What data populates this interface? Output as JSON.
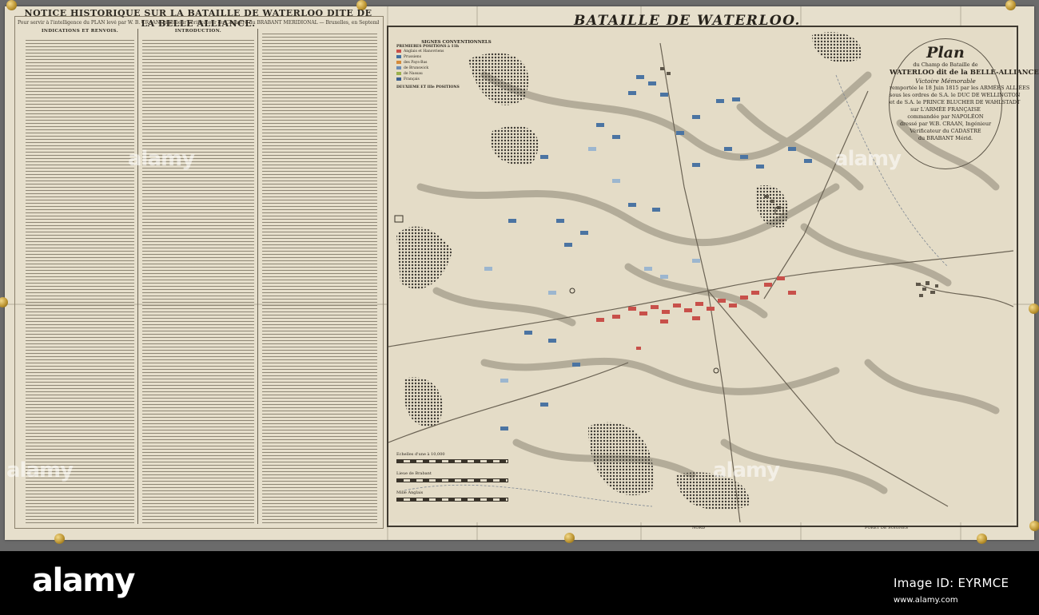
{
  "notice": {
    "title": "NOTICE HISTORIQUE SUR LA BATAILLE DE WATERLOO DITE DE LA BELLE ALLIANCE.",
    "subtitle": "Pour servir à l'intelligence du PLAN levé par W. B. CRAAN, Ingénieur Vérificateur du Cadastre du BRABANT MERIDIONAL — Bruxelles, en Septembre 1816.",
    "col1_head": "INDICATIONS ET RENVOIS.",
    "col2_head": "INTRODUCTION."
  },
  "map": {
    "title": "BATAILLE DE WATERLOO.",
    "cartouche": {
      "plan": "Plan",
      "l1": "du Champ de Bataille de",
      "l2": "WATERLOO dit de la BELLE-ALLIANCE,",
      "l3": "Victoire Mémorable",
      "l4": "remportée le 18 Juin 1815 par les ARMÉES ALLIÉES",
      "l5": "sous les ordres de S.A. le DUC DE WELLINGTON",
      "l6": "et de S.A. le PRINCE BLUCHER DE WAHLSTADT",
      "l7": "sur L'ARMÉE FRANÇAISE",
      "l8": "commandée par NAPOLÉON",
      "l9": "dressé par W.B. CRAAN, Ingénieur",
      "l10": "Vérificateur du CADASTRE",
      "l11": "du BRABANT Mérid."
    },
    "legend": {
      "head": "SIGNES CONVENTIONNELS",
      "sub1": "PREMIERES POSITIONS à 11h",
      "rows": [
        {
          "label": "Anglais et Hanovriens",
          "color": "#c8504a"
        },
        {
          "label": "Prussiens",
          "color": "#3f6fa0"
        },
        {
          "label": "des Pays-Bas",
          "color": "#d48a3a"
        },
        {
          "label": "de Brunswick",
          "color": "#6a8bb5"
        },
        {
          "label": "de Nassau",
          "color": "#9ab04d"
        },
        {
          "label": "Français",
          "color": "#3b5f8f"
        }
      ],
      "sub2": "DEUXIEME ET IIIe POSITIONS"
    },
    "scale": {
      "title": "Echelles d'une à 10,000",
      "l1": "Lieue de Brabant",
      "l2": "Mille Anglais"
    },
    "foot_center": "NORD",
    "foot_right": "FORET DE SOIGNES"
  },
  "watermarks": [
    "alamy",
    "alamy",
    "alamy",
    "alamy"
  ],
  "footer": {
    "logo": "alamy",
    "image_id": "Image ID: EYRMCE",
    "url": "www.alamy.com"
  }
}
